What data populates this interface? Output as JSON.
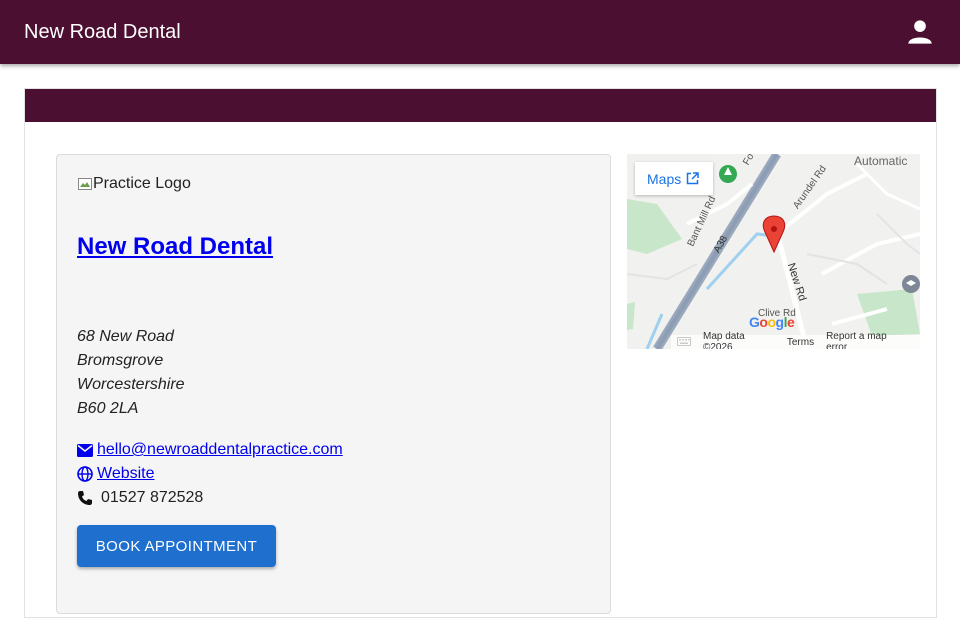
{
  "app": {
    "title": "New Road Dental"
  },
  "practice": {
    "logo_alt": "Practice Logo",
    "name": "New Road Dental",
    "address": [
      "68 New Road",
      "Bromsgrove",
      "Worcestershire",
      "B60 2LA"
    ],
    "email": "hello@newroaddentalpractice.com",
    "website_label": "Website",
    "phone": "01527 872528",
    "book_label": "BOOK APPOINTMENT"
  },
  "map": {
    "maps_button": "Maps",
    "labels": {
      "automatic": "Automatic",
      "arundel": "Arundel Rd",
      "bant_mill": "Bant Mill Rd",
      "a38": "A38",
      "new_rd": "New Rd",
      "clive": "Clive Rd",
      "fo": "Fo"
    },
    "footer": {
      "data": "Map data ©2026",
      "terms": "Terms",
      "report": "Report a map error"
    }
  },
  "colors": {
    "brand": "#4a0f31",
    "button": "#1e6fce",
    "link": "#0000ee"
  }
}
